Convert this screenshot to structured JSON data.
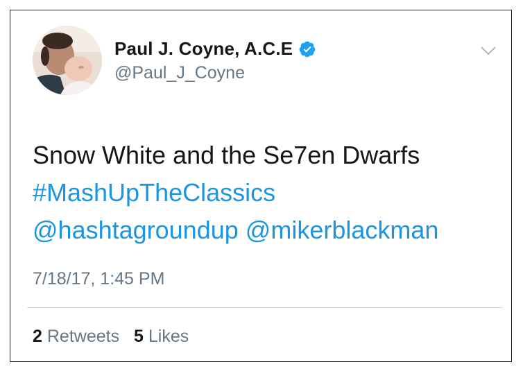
{
  "tweet": {
    "author": {
      "display_name": "Paul J. Coyne, A.C.E",
      "handle": "@Paul_J_Coyne",
      "verified_icon": "verified-badge-icon",
      "avatar_icon": "avatar"
    },
    "menu_icon": "chevron-down-icon",
    "text_line": "Snow White and the Se7en Dwarfs",
    "hashtag": "#MashUpTheClassics",
    "mention_1": "@hashtagroundup",
    "mention_2": "@mikerblackman",
    "timestamp": "7/18/17, 1:45 PM",
    "stats": {
      "retweets_count": "2",
      "retweets_label": "Retweets",
      "likes_count": "5",
      "likes_label": "Likes"
    },
    "colors": {
      "link": "#1b95e0",
      "secondary_text": "#657786",
      "primary_text": "#14171a",
      "verified": "#1da1f2"
    }
  }
}
